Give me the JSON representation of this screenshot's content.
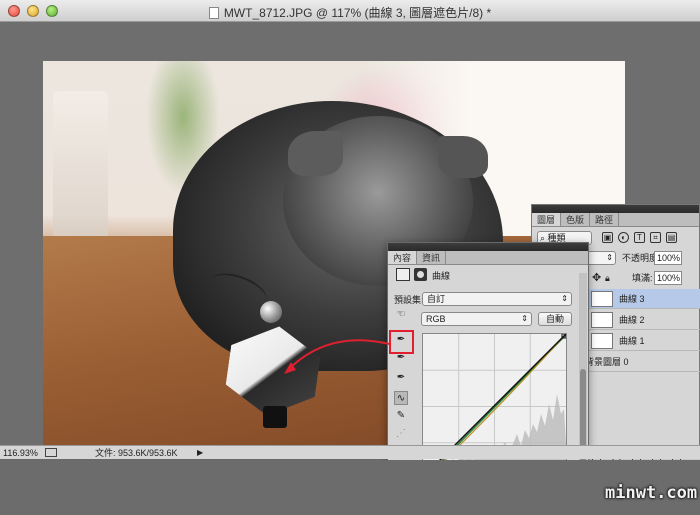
{
  "window": {
    "title": "MWT_8712.JPG @ 117% (曲線 3, 圖層遮色片/8) *"
  },
  "status": {
    "zoom": "116.93%",
    "doc_info": "文件: 953.6K/953.6K"
  },
  "layers_panel": {
    "tabs": [
      "圖層",
      "色版",
      "路徑"
    ],
    "kind_label": "種類",
    "opacity_label": "不透明度:",
    "opacity_value": "100%",
    "fill_label": "填滿:",
    "fill_value": "100%",
    "layers": [
      {
        "name": "曲線 3",
        "selected": true
      },
      {
        "name": "曲線 2",
        "selected": false
      },
      {
        "name": "曲線 1",
        "selected": false
      },
      {
        "name": "背景圖層 0",
        "selected": false
      }
    ]
  },
  "properties_panel": {
    "tabs": [
      "內容",
      "資訊"
    ],
    "header_title": "曲線",
    "preset_label": "預設集:",
    "preset_value": "自訂",
    "channel_value": "RGB",
    "auto_label": "自動"
  },
  "watermark": "minwt.com",
  "colors": {
    "annotation": "#e0202f",
    "selected_layer": "#b7c9e8",
    "panel_bg": "#d6d6d6"
  }
}
